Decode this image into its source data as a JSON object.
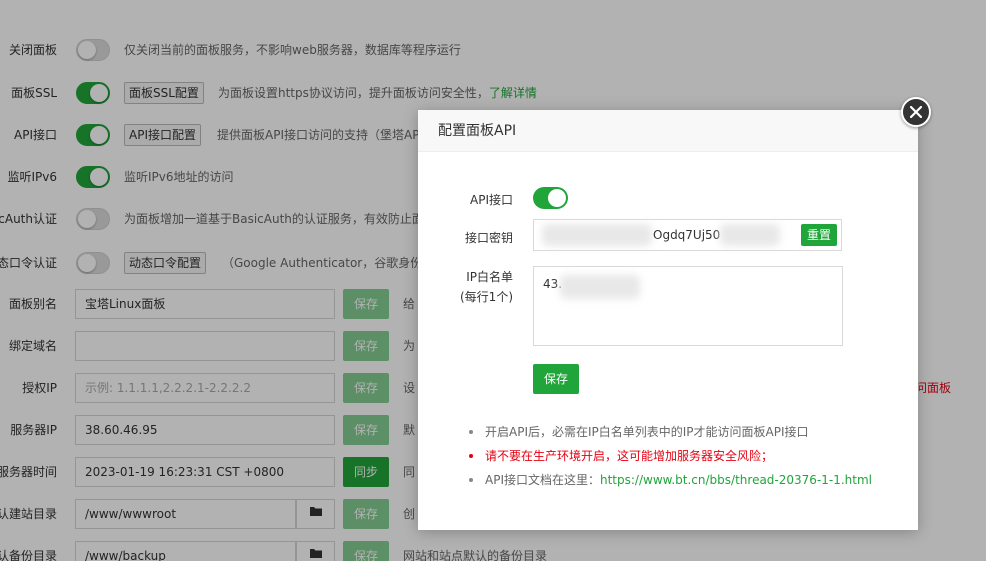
{
  "settings": {
    "rows": [
      {
        "label": "关闭面板",
        "desc": "仅关闭当前的面板服务，不影响web服务器，数据库等程序运行"
      },
      {
        "label": "面板SSL",
        "button": "面板SSL配置",
        "desc": "为面板设置https协议访问，提升面板访问安全性，",
        "desc_link": "了解详情"
      },
      {
        "label": "API接口",
        "button": "API接口配置",
        "desc": "提供面板API接口访问的支持（堡塔API"
      },
      {
        "label": "监听IPv6",
        "desc": "监听IPv6地址的访问"
      },
      {
        "label": "BasicAuth认证",
        "desc": "为面板增加一道基于BasicAuth的认证服务，有效防止面"
      },
      {
        "label": "动态口令认证",
        "button": "动态口令配置",
        "desc": "（Google Authenticator，谷歌身份认"
      },
      {
        "label": "面板别名",
        "value": "宝塔Linux面板",
        "save": "保存",
        "note": "给"
      },
      {
        "label": "绑定域名",
        "value": "",
        "save": "保存",
        "note": "为"
      },
      {
        "label": "授权IP",
        "placeholder": "示例: 1.1.1.1,2.2.2.1-2.2.2.2",
        "save": "保存",
        "note": "设",
        "red_note": "问面板"
      },
      {
        "label": "服务器IP",
        "value": "38.60.46.95",
        "save": "保存",
        "note": "默"
      },
      {
        "label": "服务器时间",
        "value": "2023-01-19 16:23:31 CST +0800",
        "save": "同步",
        "note": "同"
      },
      {
        "label": "默认建站目录",
        "value": "/www/wwwroot",
        "save": "保存",
        "note": "创"
      },
      {
        "label": "默认备份目录",
        "value": "/www/backup",
        "save": "保存",
        "note": "网站和站点默认的备份目录"
      }
    ]
  },
  "modal": {
    "title": "配置面板API",
    "api_label": "API接口",
    "api_enabled": true,
    "token_label": "接口密钥",
    "token_value": "Ogdq7Uj50",
    "reset_label": "重置",
    "ip_label": "IP白名单",
    "ip_sublabel": "(每行1个)",
    "ip_value": "43.",
    "save_label": "保存",
    "notes": [
      {
        "text": "开启API后，必需在IP白名单列表中的IP才能访问面板API接口",
        "type": "normal"
      },
      {
        "text": "请不要在生产环境开启，这可能增加服务器安全风险；",
        "type": "warning"
      },
      {
        "text": "API接口文档在这里：",
        "link": "https://www.bt.cn/bbs/thread-20376-1-1.html",
        "type": "normal"
      }
    ]
  },
  "colors": {
    "accent": "#20a53a",
    "warning": "#e60012"
  },
  "icons": {
    "close": "close-icon",
    "folder": "folder-icon"
  }
}
